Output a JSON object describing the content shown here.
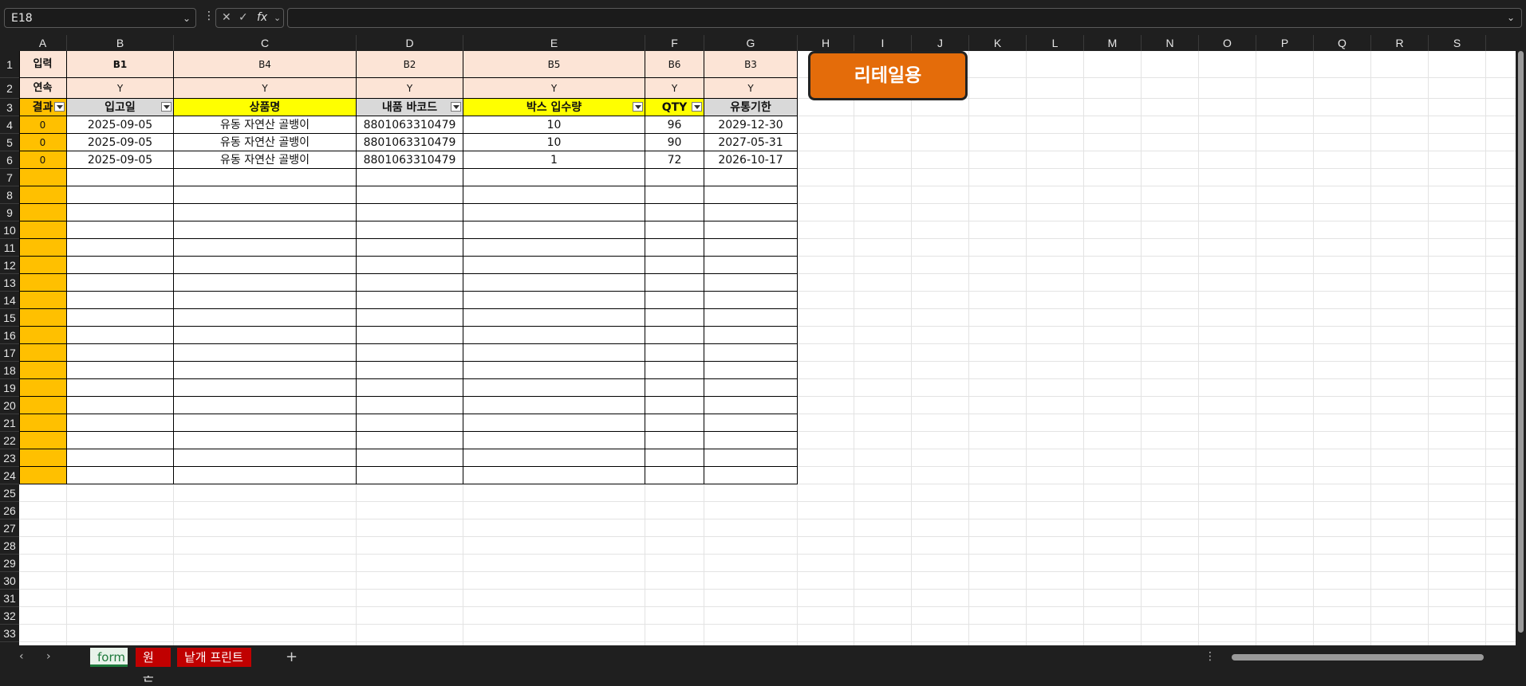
{
  "formula_bar": {
    "name_box": "E18",
    "fx": "fx",
    "formula": ""
  },
  "columns": [
    "A",
    "B",
    "C",
    "D",
    "E",
    "F",
    "G",
    "H",
    "I",
    "J",
    "K",
    "L",
    "M",
    "N",
    "O",
    "P",
    "Q",
    "R",
    "S"
  ],
  "rows": [
    "1",
    "2",
    "3",
    "4",
    "5",
    "6",
    "7",
    "8",
    "9",
    "10",
    "11",
    "12",
    "13",
    "14",
    "15",
    "16",
    "17",
    "18",
    "19",
    "20",
    "21",
    "22",
    "23",
    "24",
    "25",
    "26",
    "27",
    "28",
    "29",
    "30",
    "31",
    "32",
    "33"
  ],
  "row1": [
    "입력",
    "B1",
    "B4",
    "B2",
    "B5",
    "B6",
    "B3"
  ],
  "row2": [
    "연속",
    "Y",
    "Y",
    "Y",
    "Y",
    "Y",
    "Y"
  ],
  "headers": [
    "결과",
    "입고일",
    "상품명",
    "내품 바코드",
    "박스 입수량",
    "QTY",
    "유통기한"
  ],
  "data_rows": [
    [
      "0",
      "2025-09-05",
      "유동 자연산 골뱅이",
      "8801063310479",
      "10",
      "96",
      "2029-12-30"
    ],
    [
      "0",
      "2025-09-05",
      "유동 자연산 골뱅이",
      "8801063310479",
      "10",
      "90",
      "2027-05-31"
    ],
    [
      "0",
      "2025-09-05",
      "유동 자연산 골뱅이",
      "8801063310479",
      "1",
      "72",
      "2026-10-17"
    ]
  ],
  "button": {
    "label": "리테일용",
    "color": "#e46c0a"
  },
  "tabs": [
    {
      "label": "form",
      "active": true
    },
    {
      "label": "원본",
      "color": "#c00000"
    },
    {
      "label": "낱개 프린트",
      "color": "#c00000"
    }
  ],
  "colors": {
    "peach": "#fce4d6",
    "header_gray": "#d9d9d9",
    "header_yellow": "#ffff00",
    "result_col": "#ffc000"
  }
}
